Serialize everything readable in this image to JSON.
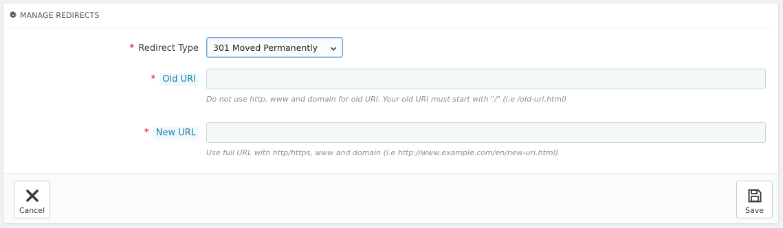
{
  "panel": {
    "title": "MANAGE REDIRECTS",
    "title_icon": "gear-icon"
  },
  "form": {
    "redirect_type": {
      "required_mark": "*",
      "label": "Redirect Type",
      "selected": "301 Moved Permanently",
      "icon": "chevron-down-icon"
    },
    "old_uri": {
      "required_mark": "*",
      "label": "Old URI",
      "value": "",
      "help": "Do not use http, www and domain for old URI. Your old URI must start with \"/\" (i.e /old-uri.html)"
    },
    "new_url": {
      "required_mark": "*",
      "label": "New URL",
      "value": "",
      "help": "Use full URL with http/https, www and domain (i.e http://www.example.com/en/new-uri.html)"
    }
  },
  "footer": {
    "cancel_label": "Cancel",
    "cancel_icon": "close-icon",
    "save_label": "Save",
    "save_icon": "floppy-disk-icon"
  },
  "colors": {
    "required": "#e0001a",
    "hint_text": "#1f7aa8",
    "hint_bg": "#eff8fb",
    "focus_border": "#6ea8d8"
  }
}
